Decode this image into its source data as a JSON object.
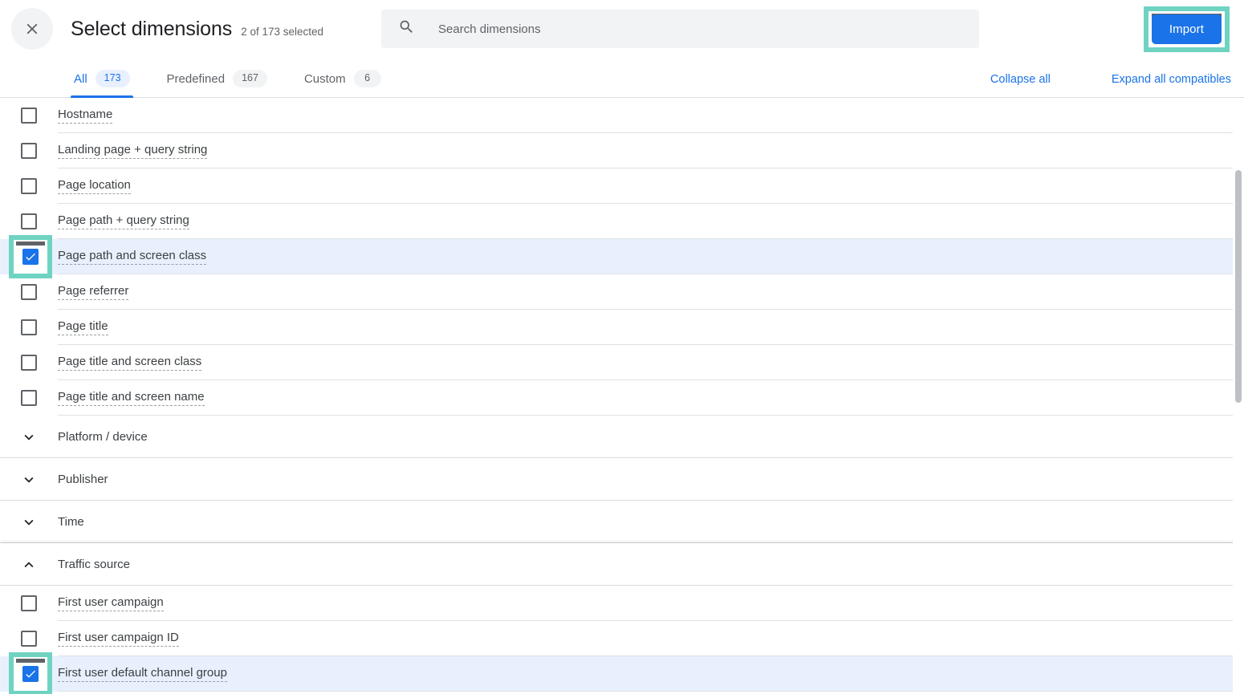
{
  "header": {
    "close_icon": "close-icon",
    "title": "Select dimensions",
    "selected_count": "2 of 173 selected",
    "search": {
      "icon": "search-icon",
      "placeholder": "Search dimensions",
      "value": ""
    },
    "import_label": "Import",
    "accent_color": "#1a73e8",
    "highlight_color": "#6fd3c2"
  },
  "tabs": [
    {
      "label": "All",
      "badge": "173",
      "active": true
    },
    {
      "label": "Predefined",
      "badge": "167",
      "active": false
    },
    {
      "label": "Custom",
      "badge": "6",
      "active": false
    }
  ],
  "tab_links": [
    {
      "label": "Collapse all"
    },
    {
      "label": "Expand all compatibles"
    }
  ],
  "rows": [
    {
      "type": "dimension",
      "label": "Hostname",
      "checked": false,
      "highlighted": false
    },
    {
      "type": "dimension",
      "label": "Landing page + query string",
      "checked": false,
      "highlighted": false
    },
    {
      "type": "dimension",
      "label": "Page location",
      "checked": false,
      "highlighted": false
    },
    {
      "type": "dimension",
      "label": "Page path + query string",
      "checked": false,
      "highlighted": false
    },
    {
      "type": "dimension",
      "label": "Page path and screen class",
      "checked": true,
      "highlighted": true
    },
    {
      "type": "dimension",
      "label": "Page referrer",
      "checked": false,
      "highlighted": false
    },
    {
      "type": "dimension",
      "label": "Page title",
      "checked": false,
      "highlighted": false
    },
    {
      "type": "dimension",
      "label": "Page title and screen class",
      "checked": false,
      "highlighted": false
    },
    {
      "type": "dimension",
      "label": "Page title and screen name",
      "checked": false,
      "highlighted": false
    },
    {
      "type": "group",
      "label": "Platform / device",
      "expanded": false
    },
    {
      "type": "group",
      "label": "Publisher",
      "expanded": false
    },
    {
      "type": "group",
      "label": "Time",
      "expanded": false
    },
    {
      "type": "group",
      "label": "Traffic source",
      "expanded": true,
      "sticky": true
    },
    {
      "type": "dimension",
      "label": "First user campaign",
      "checked": false,
      "highlighted": false
    },
    {
      "type": "dimension",
      "label": "First user campaign ID",
      "checked": false,
      "highlighted": false
    },
    {
      "type": "dimension",
      "label": "First user default channel group",
      "checked": true,
      "highlighted": true
    }
  ],
  "scrollbar": {
    "visible": true
  }
}
